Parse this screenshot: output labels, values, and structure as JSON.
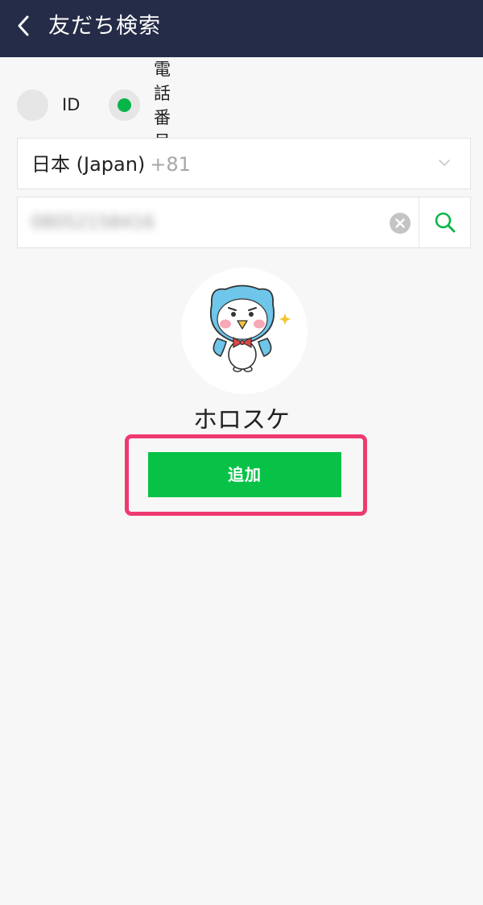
{
  "header": {
    "title": "友だち検索",
    "back_icon": "chevron-left-icon",
    "background": "#252c47"
  },
  "search_type": {
    "options": [
      {
        "label": "ID",
        "selected": false
      },
      {
        "label": "電話番号",
        "selected": true
      }
    ],
    "selected_color": "#08b548"
  },
  "country": {
    "name": "日本 (Japan)",
    "code": "+81",
    "icon": "chevron-down-icon"
  },
  "phone": {
    "value": "08052158416",
    "clear_icon": "clear-icon",
    "search_icon": "search-icon"
  },
  "profile": {
    "name": "ホロスケ",
    "avatar": "owl-mascot-avatar"
  },
  "actions": {
    "add_label": "追加",
    "add_color": "#07c247",
    "highlight_color": "#ef3a6f"
  }
}
